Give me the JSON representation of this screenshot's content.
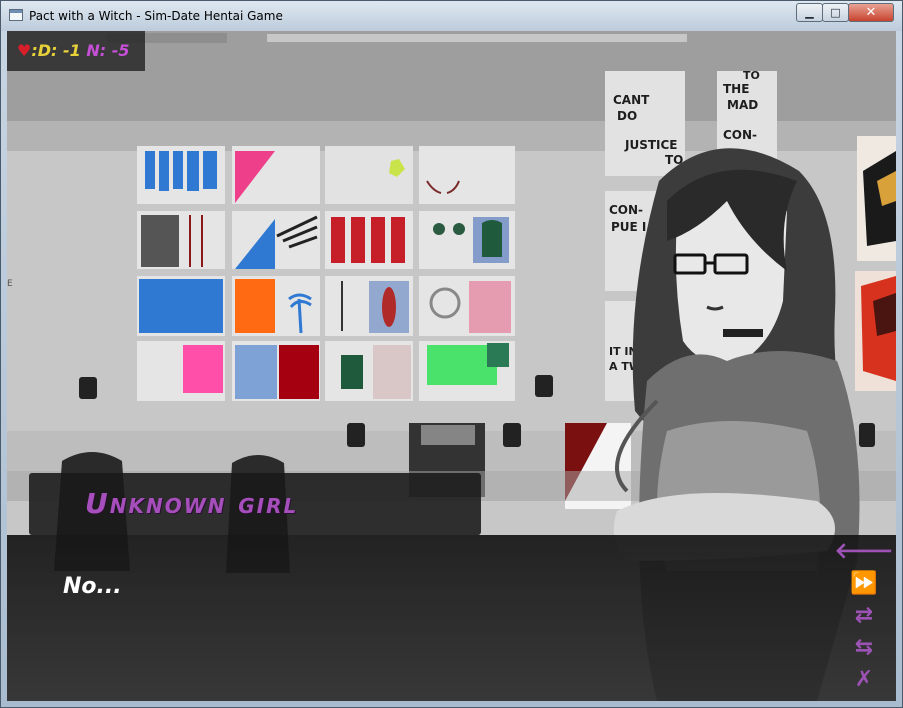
{
  "window": {
    "title": "Pact with a Witch - Sim-Date Hentai Game",
    "minimize_glyph": "▁",
    "maximize_glyph": "□",
    "close_glyph": "✕"
  },
  "hud": {
    "heart_glyph": "♥",
    "d_stat": ":D: -1",
    "n_stat": "N: -5",
    "colors": {
      "heart": "#d81f2a",
      "d": "#e8d23a",
      "n": "#c54fd6"
    }
  },
  "dialogue": {
    "speaker": "Unknown girl",
    "text": "No..."
  },
  "poster_text": {
    "poster_1": [
      "CANT",
      "DO",
      "JUSTICE",
      "TO"
    ],
    "poster_2": [
      "TO",
      "THE",
      "MAD",
      "CON-"
    ],
    "poster_3": [
      "CON-",
      "PUE I"
    ],
    "poster_4": [
      "IT IN",
      "A TWES"
    ]
  },
  "quick_menu": [
    {
      "icon": "back-arrow-icon",
      "glyph": "🡐"
    },
    {
      "icon": "skip-icon",
      "glyph": "⏩"
    },
    {
      "icon": "save-icon",
      "glyph": "⇄"
    },
    {
      "icon": "load-icon",
      "glyph": "⇆"
    },
    {
      "icon": "settings-icon",
      "glyph": "✗"
    }
  ],
  "colors": {
    "accent_purple": "#a64fbc",
    "dialogue_text": "#ffffff"
  }
}
